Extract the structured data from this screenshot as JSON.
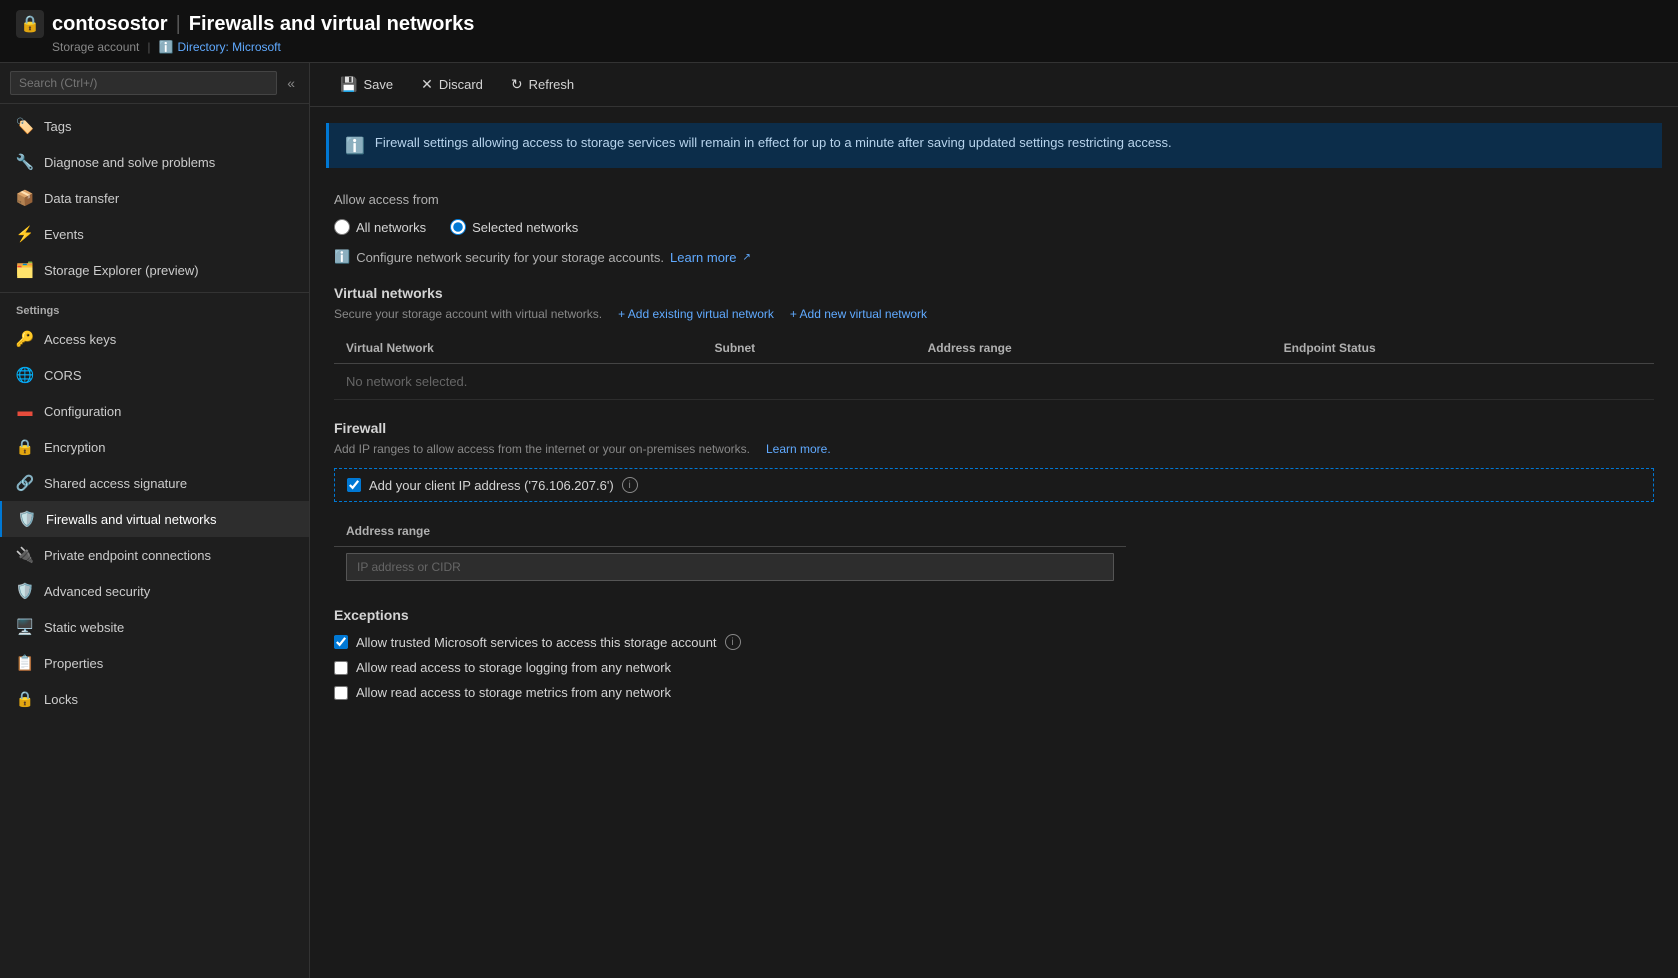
{
  "header": {
    "icon": "🔒",
    "account_name": "contosostor",
    "separator": "|",
    "page_title": "Firewalls and virtual networks",
    "subtitle_type": "Storage account",
    "subtitle_sep": "|",
    "subtitle_directory_icon": "ℹ",
    "subtitle_directory": "Directory: Microsoft"
  },
  "sidebar": {
    "search_placeholder": "Search (Ctrl+/)",
    "collapse_icon": "«",
    "items_top": [
      {
        "id": "tags",
        "label": "Tags",
        "icon": "🏷"
      },
      {
        "id": "diagnose",
        "label": "Diagnose and solve problems",
        "icon": "🔧"
      },
      {
        "id": "data-transfer",
        "label": "Data transfer",
        "icon": "📦"
      },
      {
        "id": "events",
        "label": "Events",
        "icon": "⚡"
      },
      {
        "id": "storage-explorer",
        "label": "Storage Explorer (preview)",
        "icon": "🗂"
      }
    ],
    "section_label": "Settings",
    "items_settings": [
      {
        "id": "access-keys",
        "label": "Access keys",
        "icon": "🔑"
      },
      {
        "id": "cors",
        "label": "CORS",
        "icon": "🌐"
      },
      {
        "id": "configuration",
        "label": "Configuration",
        "icon": "🟥"
      },
      {
        "id": "encryption",
        "label": "Encryption",
        "icon": "🔒"
      },
      {
        "id": "shared-access",
        "label": "Shared access signature",
        "icon": "🔗"
      },
      {
        "id": "firewalls",
        "label": "Firewalls and virtual networks",
        "icon": "🛡",
        "active": true
      },
      {
        "id": "private-endpoint",
        "label": "Private endpoint connections",
        "icon": "🔌"
      },
      {
        "id": "advanced-security",
        "label": "Advanced security",
        "icon": "🛡"
      },
      {
        "id": "static-website",
        "label": "Static website",
        "icon": "🖥"
      },
      {
        "id": "properties",
        "label": "Properties",
        "icon": "📋"
      },
      {
        "id": "locks",
        "label": "Locks",
        "icon": "🔒"
      }
    ]
  },
  "toolbar": {
    "save_label": "Save",
    "save_icon": "💾",
    "discard_label": "Discard",
    "discard_icon": "✕",
    "refresh_label": "Refresh",
    "refresh_icon": "↻"
  },
  "info_banner": {
    "text": "Firewall settings allowing access to storage services will remain in effect for up to a minute after saving updated settings restricting access."
  },
  "allow_access": {
    "label": "Allow access from",
    "option_all": "All networks",
    "option_selected": "Selected networks",
    "selected_checked": true,
    "info_text": "Configure network security for your storage accounts.",
    "learn_more": "Learn more"
  },
  "virtual_networks": {
    "heading": "Virtual networks",
    "subtext": "Secure your storage account with virtual networks.",
    "add_existing": "+ Add existing virtual network",
    "add_new": "+ Add new virtual network",
    "table_columns": [
      "Virtual Network",
      "Subnet",
      "Address range",
      "Endpoint Status"
    ],
    "empty_message": "No network selected."
  },
  "firewall": {
    "heading": "Firewall",
    "subtext": "Add IP ranges to allow access from the internet or your on-premises networks.",
    "learn_more": "Learn more.",
    "add_client_ip_label": "Add your client IP address ('76.106.207.6')",
    "add_client_ip_checked": true,
    "address_range_col": "Address range",
    "ip_placeholder": "IP address or CIDR"
  },
  "exceptions": {
    "heading": "Exceptions",
    "items": [
      {
        "id": "trusted-ms",
        "label": "Allow trusted Microsoft services to access this storage account",
        "checked": true,
        "has_info": true
      },
      {
        "id": "read-logging",
        "label": "Allow read access to storage logging from any network",
        "checked": false,
        "has_info": false
      },
      {
        "id": "read-metrics",
        "label": "Allow read access to storage metrics from any network",
        "checked": false,
        "has_info": false
      }
    ]
  }
}
